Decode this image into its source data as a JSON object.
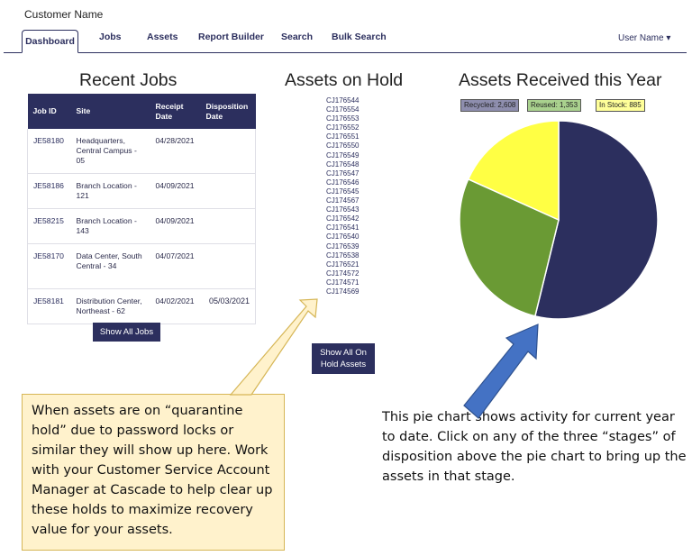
{
  "header": {
    "customer_name": "Customer Name",
    "user_menu": "User Name ▾"
  },
  "nav": {
    "tabs": [
      {
        "label": "Dashboard",
        "active": true
      },
      {
        "label": "Jobs"
      },
      {
        "label": "Assets"
      },
      {
        "label": "Report Builder"
      },
      {
        "label": "Search"
      },
      {
        "label": "Bulk Search"
      }
    ]
  },
  "recent_jobs": {
    "title": "Recent Jobs",
    "columns": [
      "Job ID",
      "Site",
      "Receipt Date",
      "Disposition Date"
    ],
    "rows": [
      {
        "job_id": "JE58180",
        "site": "Headquarters, Central Campus - 05",
        "receipt": "04/28/2021",
        "disposition": ""
      },
      {
        "job_id": "JE58186",
        "site": "Branch Location - 121",
        "receipt": "04/09/2021",
        "disposition": ""
      },
      {
        "job_id": "JE58215",
        "site": "Branch Location - 143",
        "receipt": "04/09/2021",
        "disposition": ""
      },
      {
        "job_id": "JE58170",
        "site": "Data Center, South Central - 34",
        "receipt": "04/07/2021",
        "disposition": ""
      },
      {
        "job_id": "JE58181",
        "site": "Distribution Center, Northeast - 62",
        "receipt": "04/02/2021",
        "disposition": "05/03/2021"
      }
    ],
    "button": "Show All Jobs"
  },
  "assets_on_hold": {
    "title": "Assets on Hold",
    "items": [
      "CJ176544",
      "CJ176554",
      "CJ176553",
      "CJ176552",
      "CJ176551",
      "CJ176550",
      "CJ176549",
      "CJ176548",
      "CJ176547",
      "CJ176546",
      "CJ176545",
      "CJ174567",
      "CJ176543",
      "CJ176542",
      "CJ176541",
      "CJ176540",
      "CJ176539",
      "CJ176538",
      "CJ176521",
      "CJ174572",
      "CJ174571",
      "CJ174569"
    ],
    "button_line1": "Show All On",
    "button_line2": "Hold Assets"
  },
  "assets_received": {
    "title": "Assets Received this Year",
    "legend": [
      {
        "label": "Recycled: 2,608",
        "color": "#8e8eae"
      },
      {
        "label": "Reused: 1,353",
        "color": "#a9d18e"
      },
      {
        "label": "In Stock: 885",
        "color": "#ffff99"
      }
    ]
  },
  "chart_data": {
    "type": "pie",
    "labels": [
      "Recycled",
      "Reused",
      "In Stock"
    ],
    "values": [
      2608,
      1353,
      885
    ],
    "colors": [
      "#2c2f5e",
      "#6a9a34",
      "#ffff44"
    ]
  },
  "annotations": {
    "hold_callout": "When assets are on “quarantine hold” due to password locks or similar they will show up here. Work with your Customer Service Account Manager at Cascade to help clear up these holds to maximize recovery value for your assets.",
    "pie_note": "This pie chart shows activity for current year to date. Click on any of the three “stages” of disposition above the pie chart to bring up the assets in that stage."
  }
}
